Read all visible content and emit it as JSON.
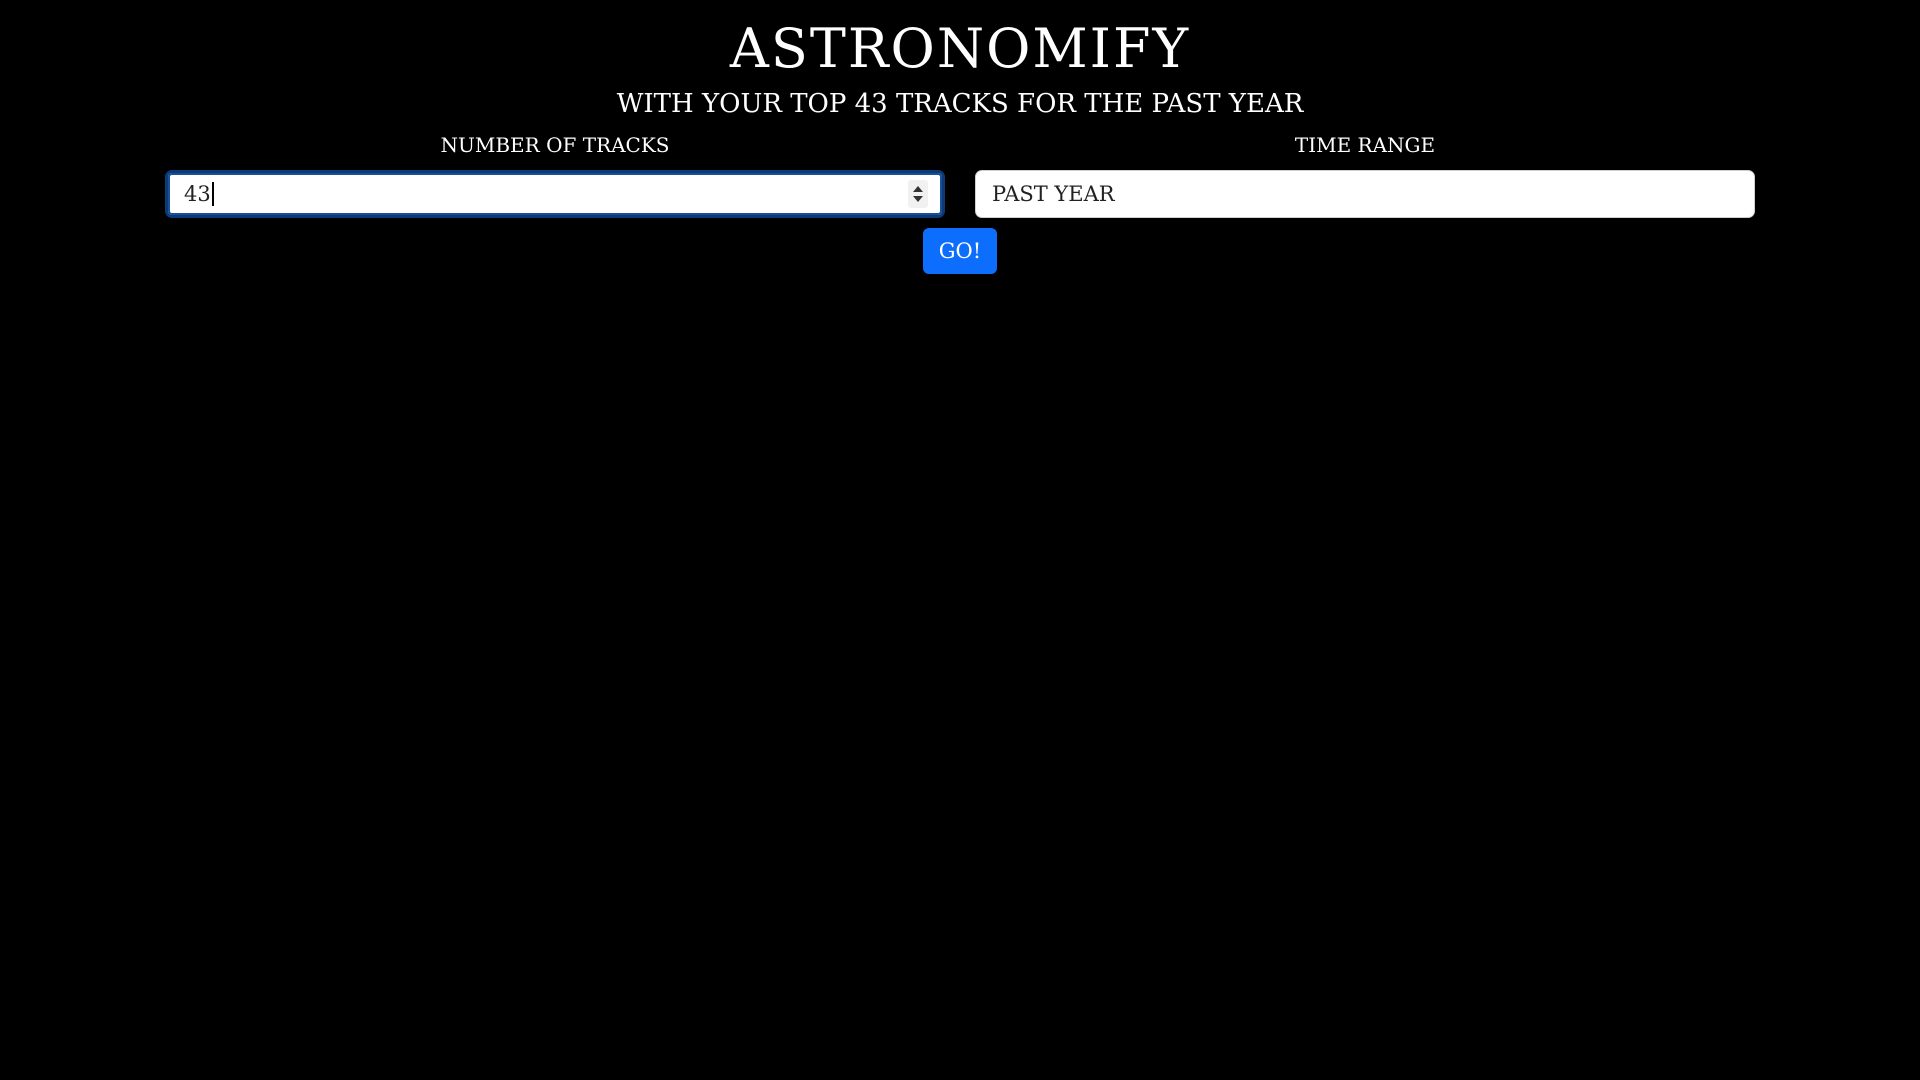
{
  "app": {
    "title": "ASTRONOMIFY",
    "subtitle": "WITH YOUR TOP 43 TRACKS FOR THE PAST YEAR"
  },
  "form": {
    "tracks_label": "NUMBER OF TRACKS",
    "tracks_value": "43",
    "time_range_label": "TIME RANGE",
    "time_range_value": "PAST YEAR",
    "go_label": "GO!"
  },
  "colors": {
    "background": "#000000",
    "text": "#ffffff",
    "button": "#0d6efd",
    "focus_border": "#0b3a78"
  },
  "icons": {
    "stepper_up": "chevron-up-icon",
    "stepper_down": "chevron-down-icon"
  }
}
